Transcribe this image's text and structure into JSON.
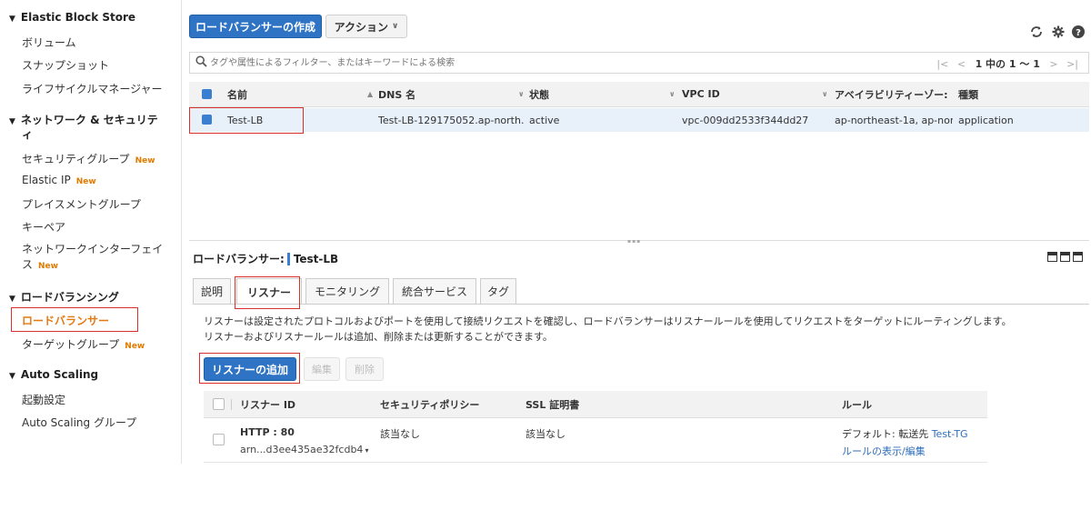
{
  "sidebar": {
    "sections": [
      {
        "label": "Elastic Block Store"
      },
      {
        "label": "ネットワーク & セキュリテ"
      },
      {
        "label": "ロードバランシング"
      },
      {
        "label": "Auto Scaling"
      }
    ],
    "network_wrap": "ィ",
    "items": {
      "volumes": "ボリューム",
      "snapshots": "スナップショット",
      "lifecycle": "ライフサイクルマネージャー",
      "security_groups": "セキュリティグループ",
      "elastic_ip": "Elastic IP",
      "placement_groups": "プレイスメントグループ",
      "key_pairs": "キーペア",
      "network_interfaces_1": "ネットワークインターフェイ",
      "network_interfaces_2": "ス",
      "load_balancers": "ロードバランサー",
      "target_groups": "ターゲットグループ",
      "launch_config": "起動設定",
      "asg": "Auto Scaling グループ"
    },
    "new_badge": "New"
  },
  "toolbar": {
    "create_lb": "ロードバランサーの作成",
    "actions": "アクション"
  },
  "search": {
    "placeholder": "タグや属性によるフィルター、またはキーワードによる検索"
  },
  "pager": {
    "text": "1 中の 1 〜 1"
  },
  "table": {
    "headers": [
      "名前",
      "DNS 名",
      "状態",
      "VPC ID",
      "アベイラビリティーゾー:",
      "種類"
    ],
    "row": {
      "name": "Test-LB",
      "dns": "Test-LB-129175052.ap-north...",
      "state": "active",
      "vpc": "vpc-009dd2533f344dd27",
      "az": "ap-northeast-1a, ap-nor...",
      "type": "application"
    }
  },
  "detail": {
    "title_label": "ロードバランサー:",
    "title_value": "Test-LB",
    "tabs": [
      "説明",
      "リスナー",
      "モニタリング",
      "統合サービス",
      "タグ"
    ],
    "desc_line1": "リスナーは設定されたプロトコルおよびポートを使用して接続リクエストを確認し、ロードバランサーはリスナールールを使用してリクエストをターゲットにルーティングします。",
    "desc_line2": "リスナーおよびリスナールールは追加、削除または更新することができます。",
    "add_listener": "リスナーの追加",
    "edit": "編集",
    "delete": "削除"
  },
  "listeners": {
    "headers": [
      "リスナー ID",
      "セキュリティポリシー",
      "SSL 証明書",
      "ルール"
    ],
    "row": {
      "id": "HTTP : 80",
      "arn": "arn...d3ee435ae32fcdb4",
      "policy": "該当なし",
      "ssl": "該当なし",
      "rule_prefix": "デフォルト: 転送先",
      "rule_target": "Test-TG",
      "rule_link": "ルールの表示/編集"
    }
  },
  "colors": {
    "primary": "#2f74c4",
    "active_nav": "#e47911",
    "highlight": "#d9302c"
  }
}
